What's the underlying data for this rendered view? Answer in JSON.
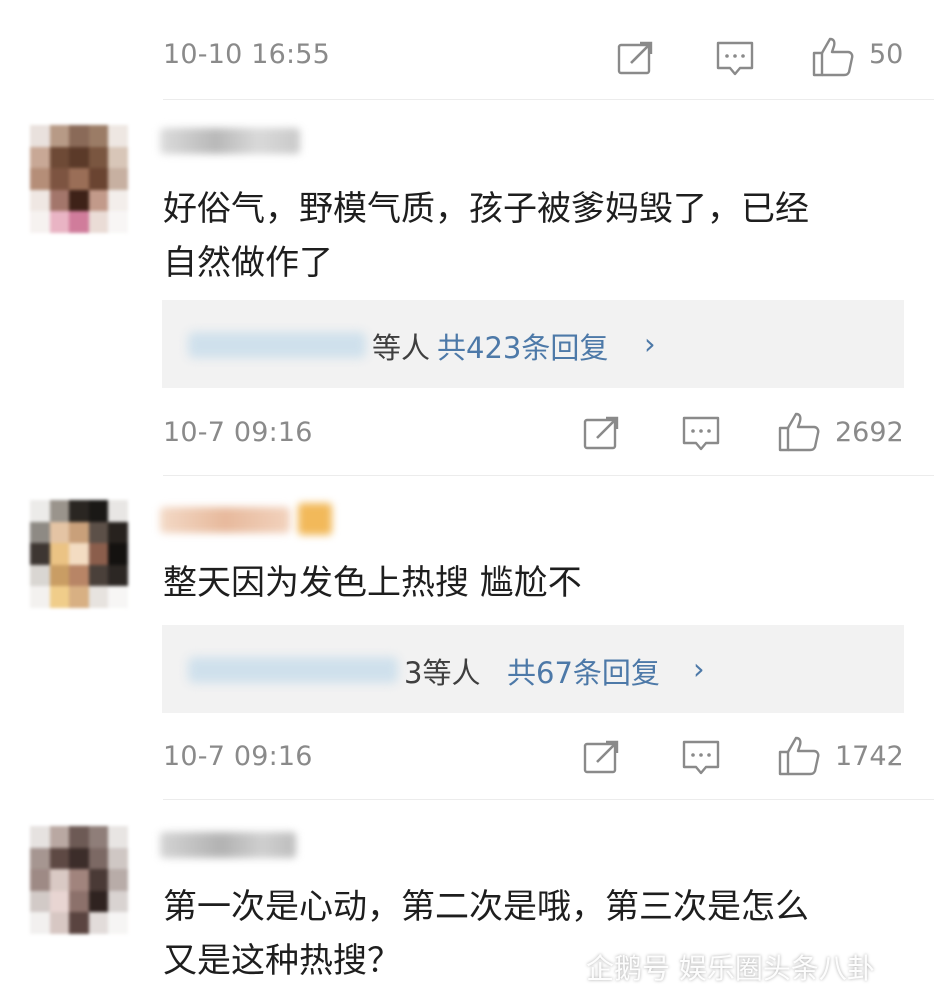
{
  "colors": {
    "meta_gray": "#8a8a8a",
    "link_blue": "#4d79a8",
    "reply_bg": "#f2f2f2",
    "divider": "#ececec"
  },
  "top_row": {
    "timestamp": "10-10 16:55",
    "like_count": "50"
  },
  "comments": [
    {
      "text_line1": "好俗气，野模气质，孩子被爹妈毁了，已经",
      "text_line2": "自然做作了",
      "reply_people": "等人",
      "reply_count": "共423条回复",
      "chevron": "›",
      "timestamp": "10-7 09:16",
      "like_count": "2692"
    },
    {
      "text_line1": "整天因为发色上热搜 尴尬不",
      "reply_people": "3等人",
      "reply_count": "共67条回复",
      "chevron": "›",
      "timestamp": "10-7 09:16",
      "like_count": "1742"
    },
    {
      "text_line1": "第一次是心动，第二次是哦，第三次是怎么",
      "text_line2": "又是这种热搜？"
    }
  ],
  "icons": {
    "share": "share-icon",
    "comment": "comment-icon",
    "like": "thumbs-up-icon"
  },
  "watermark": {
    "text": "企鹅号 娱乐圈头条八卦"
  }
}
